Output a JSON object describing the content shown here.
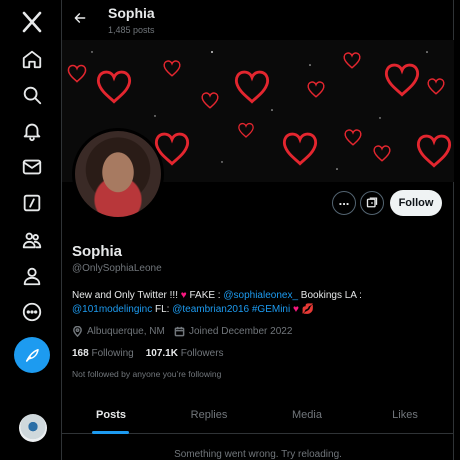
{
  "nav": {
    "items": [
      {
        "name": "x-logo-icon"
      },
      {
        "name": "home-icon"
      },
      {
        "name": "explore-icon"
      },
      {
        "name": "notifications-icon"
      },
      {
        "name": "messages-icon"
      },
      {
        "name": "grok-icon"
      },
      {
        "name": "communities-icon"
      },
      {
        "name": "profile-icon"
      },
      {
        "name": "more-icon"
      }
    ],
    "compose_icon": "feather-icon",
    "accent": "#1d9bf0"
  },
  "header": {
    "title": "Sophia",
    "post_count": "1,485 posts"
  },
  "banner": {
    "theme": "red neon hearts on black",
    "heart_color": "#e3262f"
  },
  "profile": {
    "name": "Sophia",
    "handle": "@OnlySophiaLeone",
    "bio": {
      "t1": "New and Only Twitter !!! ",
      "h1": "♥",
      "t2": " FAKE : ",
      "l1": "@sophialeonex_",
      "t3": " Bookings LA :",
      "l2": "@101modelinginc",
      "t4": " FL: ",
      "l3": "@teambrian2016",
      "t5": " ",
      "l4": "#GEMini",
      "h2": " ♥ 💋"
    },
    "location": "Albuquerque, NM",
    "joined": "Joined December 2022",
    "following_count": "168",
    "following_label": "Following",
    "followers_count": "107.1K",
    "followers_label": "Followers",
    "not_followed_text": "Not followed by anyone you’re following",
    "follow_label": "Follow"
  },
  "tabs": [
    {
      "label": "Posts",
      "active": true
    },
    {
      "label": "Replies"
    },
    {
      "label": "Media"
    },
    {
      "label": "Likes"
    }
  ],
  "error_text": "Something went wrong. Try reloading."
}
